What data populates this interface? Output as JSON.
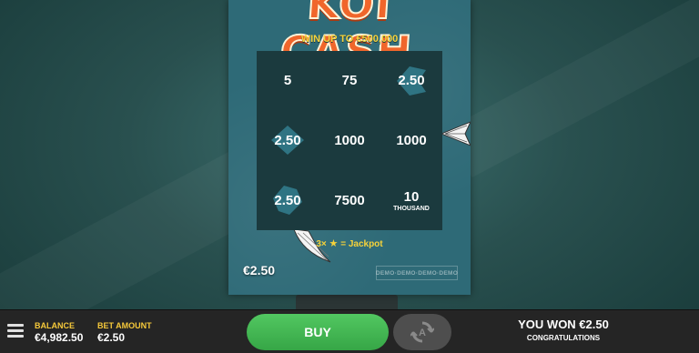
{
  "game": {
    "logo": "KOI CASH",
    "tagline": "WIN UP TO €500,000",
    "grid": [
      {
        "value": "5",
        "sub": "",
        "fish": false
      },
      {
        "value": "75",
        "sub": "",
        "fish": false
      },
      {
        "value": "2.50",
        "sub": "",
        "fish": true
      },
      {
        "value": "2.50",
        "sub": "",
        "fish": true
      },
      {
        "value": "1000",
        "sub": "",
        "fish": false
      },
      {
        "value": "1000",
        "sub": "",
        "fish": false
      },
      {
        "value": "2.50",
        "sub": "",
        "fish": true
      },
      {
        "value": "7500",
        "sub": "",
        "fish": false
      },
      {
        "value": "10",
        "sub": "THOUSAND",
        "fish": false
      }
    ],
    "jackpot": {
      "multiplier": "3×",
      "rest": "= Jackpot"
    },
    "ticket_price": "€2.50",
    "demo_text": "DEMO·DEMO·DEMO·DEMO",
    "colors": {
      "accent_gold": "#f6d23a",
      "logo_orange": "#f0662b",
      "buy_green": "#3fb44f"
    }
  },
  "bottom_bar": {
    "balance_label": "BALANCE",
    "balance_value": "€4,982.50",
    "bet_label": "BET AMOUNT",
    "bet_value": "€2.50",
    "buy_label": "BUY",
    "autoplay_icon": "autoplay-icon",
    "win_text": "YOU WON €2.50",
    "congrats_text": "CONGRATULATIONS"
  }
}
